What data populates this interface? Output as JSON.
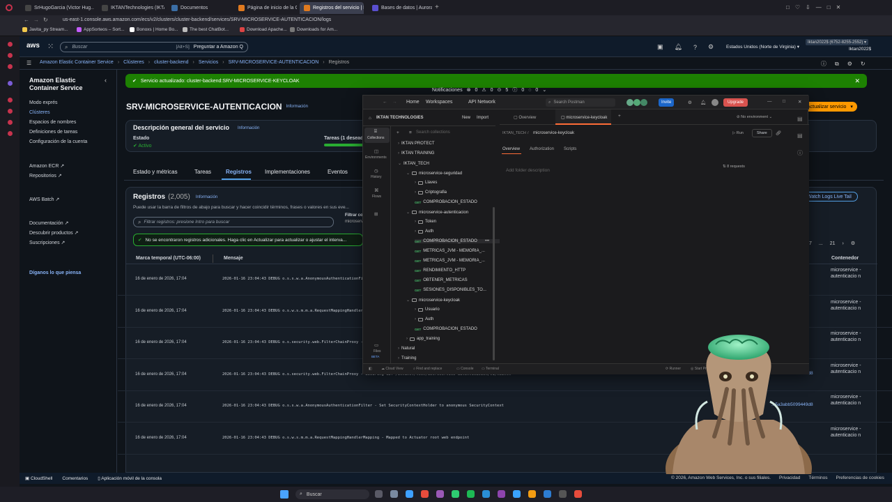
{
  "browser": {
    "tabs": [
      {
        "label": "SrHugoGarcia (Victor Hug...",
        "color": "#444"
      },
      {
        "label": "IKTANTechnologies (IKTA...",
        "color": "#444"
      },
      {
        "label": "Documentos",
        "color": "#3b6ea5"
      },
      {
        "label": "Página de inicio de la Con...",
        "color": "#e07a1f"
      },
      {
        "label": "Registros del servicio | El...",
        "color": "#e07a1f"
      },
      {
        "label": "Bases de datos | Aurora e...",
        "color": "#5a4fcf"
      }
    ],
    "url": "us-east-1.console.aws.amazon.com/ecs/v2/clusters/cluster-backend/services/SRV-MICROSERVICE-AUTENTICACION/logs",
    "bookmarks": [
      "Javita_py Stream...",
      "AppSorteos – Sort...",
      "Bonoxs | Home Bo...",
      "The best ChatBot...",
      "Download Apache...",
      "Downloads for Am..."
    ]
  },
  "aws": {
    "logo": "aws",
    "search_placeholder": "Buscar",
    "search_shortcut": "[Alt+S]",
    "ask_q": "Preguntar a Amazon Q",
    "region": "Estados Unidos (Norte de Virginia) ▾",
    "account_id": "Iktan2022$ (6752-8255-2552) ▾",
    "account_user": "Iktan2022$",
    "breadcrumb": [
      "Amazon Elastic Container Service",
      "Clústeres",
      "cluster-backend",
      "Servicios",
      "SRV-MICROSERVICE-AUTENTICACION",
      "Registros"
    ],
    "sidebar": {
      "title": "Amazon Elastic Container Service",
      "items": [
        "Modo exprés",
        "Clústeres",
        "Espacios de nombres",
        "Definiciones de tareas",
        "Configuración de la cuenta"
      ],
      "items2": [
        "Amazon ECR ↗",
        "Repositorios ↗"
      ],
      "items3": [
        "AWS Batch ↗"
      ],
      "items4": [
        "Documentación ↗",
        "Descubrir productos ↗",
        "Suscripciones ↗"
      ],
      "feedback": "Díganos lo que piensa"
    },
    "flash": "Servicio actualizado: cluster-backend:SRV-MICROSERVICE-KEYCLOAK",
    "notifications": {
      "label": "Notificaciones",
      "counts": [
        "0",
        "0",
        "5",
        "0",
        "0"
      ]
    },
    "service_title": "SRV-MICROSERVICE-AUTENTICACION",
    "info": "Información",
    "update_button": "Actualizar servicio",
    "overview": {
      "title": "Descripción general del servicio",
      "estado_label": "Estado",
      "estado_value": "Activo",
      "tareas_label": "Tareas (1 deseada)"
    },
    "tabs": [
      "Estado y métricas",
      "Tareas",
      "Registros",
      "Implementaciones",
      "Eventos"
    ],
    "logs": {
      "title": "Registros",
      "count": "(2,005)",
      "desc": "Puede usar la barra de filtros de abajo para buscar y hacer coincidir términos, frases o valores en sus eve...",
      "filter_placeholder": "Filtrar registros: presione Intro para buscar",
      "filter_label": "Filtrar co",
      "filter_value": "microserv",
      "live_tail": "Watch Logs Live Tail",
      "notice": "No se encontraron registros adicionales. Haga clic en Actualizar para actualizar o ajustar el interva...",
      "pager": [
        "7",
        "...",
        "21"
      ],
      "col_time": "Marca temporal (UTC-06:00)",
      "col_msg": "Mensaje",
      "col_container": "Contenedor",
      "rows": [
        {
          "time": "16 de enero de 2026, 17:04",
          "msg": "2026-01-16 23:04:43 DEBUG o.s.s.w.a.AnonymousAuthenticationFi...",
          "hash": "...9d8",
          "container": "microservice - autenticacio n"
        },
        {
          "time": "16 de enero de 2026, 17:04",
          "msg": "2026-01-16 23:04:43 DEBUG o.s.w.s.m.m.a.RequestMappingHandler...",
          "hash": "...9d8",
          "container": "microservice - autenticacio n"
        },
        {
          "time": "16 de enero de 2026, 17:04",
          "msg": "2026-01-16 23:04:43 DEBUG o.s.security.web.FilterChainProxy - ...",
          "hash": "...9d8",
          "container": "microservice - autenticacio n"
        },
        {
          "time": "16 de enero de 2026, 17:04",
          "msg": "2026-01-16 23:04:43 DEBUG o.s.security.web.FilterChainProxy - Securing GET /iktanst/tech/microservice-autenticacion/v1/health",
          "hash": "...5a3abb5099449d8",
          "container": "microservice - autenticacio n"
        },
        {
          "time": "16 de enero de 2026, 17:04",
          "msg": "2026-01-16 23:04:43 DEBUG o.s.s.w.a.AnonymousAuthenticationFilter - Set SecurityContextHolder to anonymous SecurityContext",
          "hash": "...5a3abb5099449d8",
          "container": "microservice - autenticacio n"
        },
        {
          "time": "16 de enero de 2026, 17:04",
          "msg": "2026-01-16 23:04:43 DEBUG o.s.w.s.m.m.a.RequestMappingHandlerMapping - Mapped to Actuator root web endpoint",
          "hash": "...9d8",
          "container": "microservice - autenticacio n"
        }
      ]
    },
    "footer": {
      "left": [
        "CloudShell",
        "Comentarios",
        "Aplicación móvil de la consola"
      ],
      "right": [
        "© 2026, Amazon Web Services, Inc. o sus filiales.",
        "Privacidad",
        "Términos",
        "Preferencias de cookies"
      ]
    }
  },
  "postman": {
    "nav": [
      "Home",
      "Workspaces",
      "API Network"
    ],
    "search": "Search Postman",
    "invite": "Invite",
    "upgrade": "Upgrade",
    "workspace": "IKTAN TECHNOLOGIES",
    "new": "New",
    "import": "Import",
    "side_tabs": [
      "Collections",
      "Environments",
      "History",
      "Flows"
    ],
    "search_collections": "Search collections",
    "tree": [
      {
        "d": 0,
        "t": "c",
        "label": "IKTAN PROTECT"
      },
      {
        "d": 0,
        "t": "c",
        "label": "IKTAN TRAINING"
      },
      {
        "d": 0,
        "t": "o",
        "label": "IKTAN_TECH"
      },
      {
        "d": 1,
        "t": "fo",
        "label": "microservice-seguridad"
      },
      {
        "d": 2,
        "t": "f",
        "label": "Llaves"
      },
      {
        "d": 2,
        "t": "f",
        "label": "Criptografia"
      },
      {
        "d": 2,
        "t": "g",
        "label": "COMPROBACION_ESTADO"
      },
      {
        "d": 1,
        "t": "fo",
        "label": "microservice-autenticacion"
      },
      {
        "d": 2,
        "t": "f",
        "label": "Token"
      },
      {
        "d": 2,
        "t": "f",
        "label": "Auth"
      },
      {
        "d": 2,
        "t": "g",
        "label": "COMPROBACION_ESTADO"
      },
      {
        "d": 2,
        "t": "g",
        "label": "METRICAS_JVM - MEMORIA_..."
      },
      {
        "d": 2,
        "t": "g",
        "label": "METRICAS_JVM - MEMORIA_..."
      },
      {
        "d": 2,
        "t": "g",
        "label": "RENDIMIENTO_HTTP"
      },
      {
        "d": 2,
        "t": "g",
        "label": "OBTENER_METRICAS"
      },
      {
        "d": 2,
        "t": "g",
        "label": "SESIONES_DISPONIBLES_TO..."
      },
      {
        "d": 1,
        "t": "fo",
        "label": "microservice-keycloak"
      },
      {
        "d": 2,
        "t": "f",
        "label": "Usuario"
      },
      {
        "d": 2,
        "t": "f",
        "label": "Auth"
      },
      {
        "d": 2,
        "t": "g",
        "label": "COMPROBACION_ESTADO"
      },
      {
        "d": 1,
        "t": "f",
        "label": "app_training"
      },
      {
        "d": 0,
        "t": "c",
        "label": "Natural"
      },
      {
        "d": 0,
        "t": "c",
        "label": "Training"
      }
    ],
    "tabs": [
      "Overview",
      "microservice-keycloak"
    ],
    "env": "No environment",
    "crumb": [
      "IKTAN_TECH",
      "microservice-keycloak"
    ],
    "run": "Run",
    "share": "Share",
    "subtabs": [
      "Overview",
      "Authorization",
      "Scripts"
    ],
    "folder_desc": "Add folder description",
    "requests": "8 requests",
    "files": "Files",
    "beta": "BETA",
    "status": [
      "Cloud View",
      "Find and replace",
      "Console",
      "Terminal"
    ],
    "status_right": [
      "Runner",
      "Start Proxy"
    ]
  },
  "taskbar": {
    "search": "Buscar"
  }
}
